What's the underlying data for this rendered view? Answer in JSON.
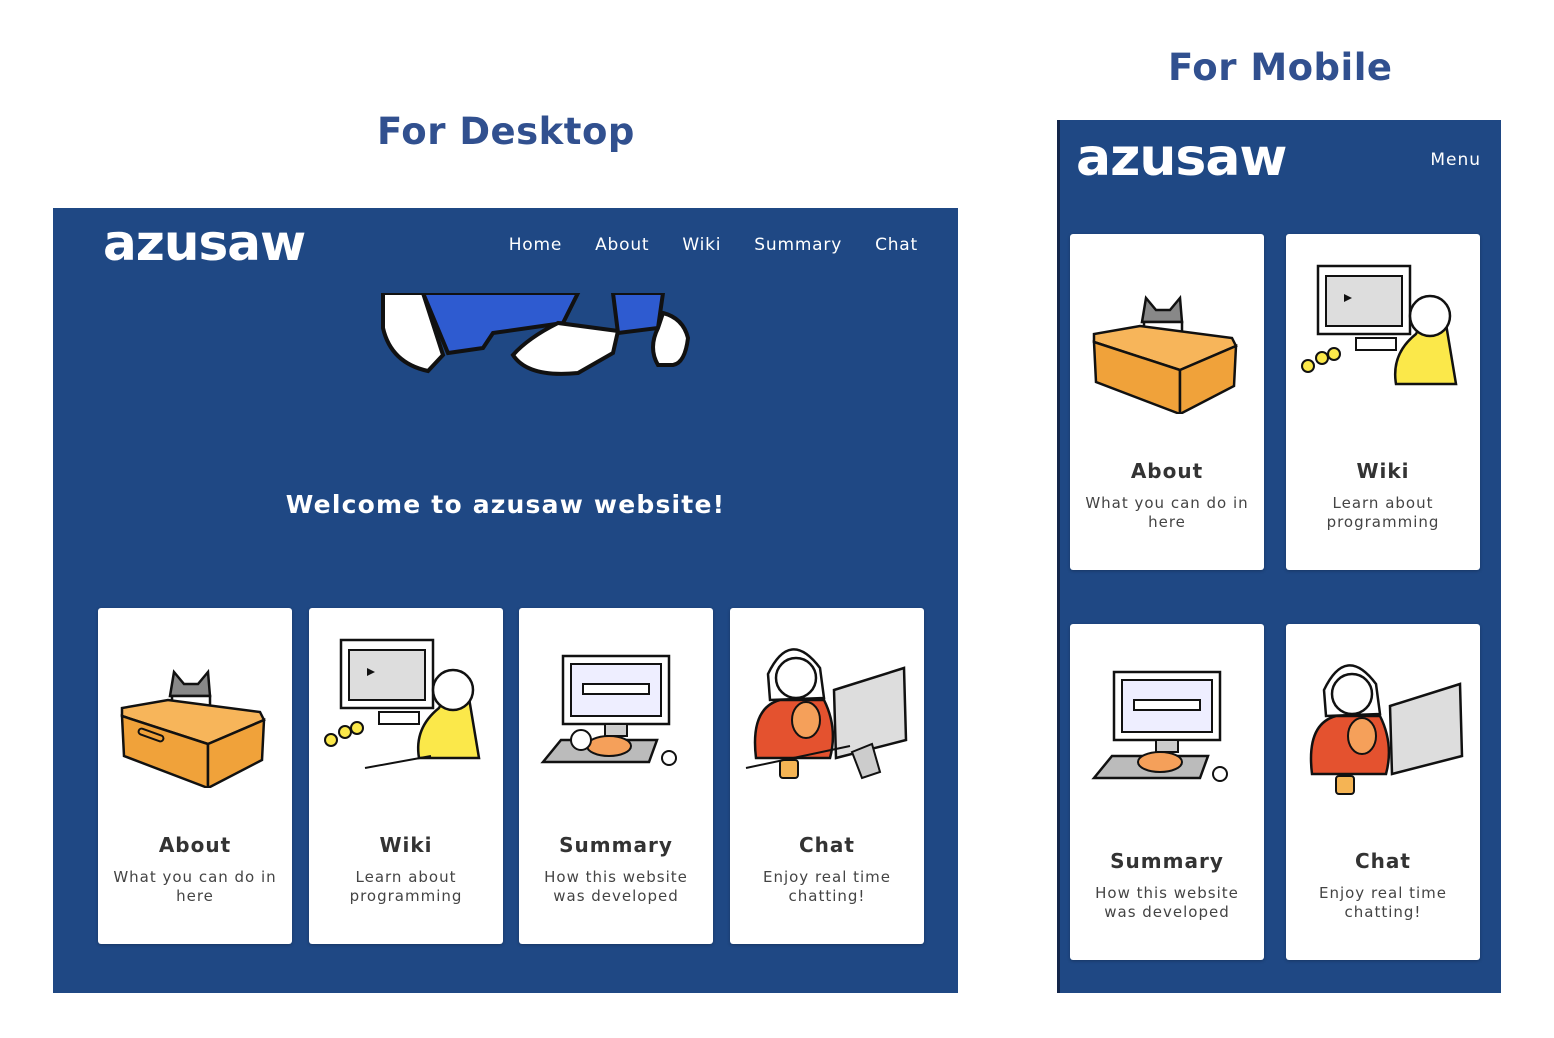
{
  "headings": {
    "desktop": "For Desktop",
    "mobile": "For Mobile"
  },
  "site": {
    "logo": "azusaw",
    "welcome": "Welcome to azusaw website!",
    "menu_label": "Menu"
  },
  "nav": [
    "Home",
    "About",
    "Wiki",
    "Summary",
    "Chat"
  ],
  "cards": [
    {
      "title": "About",
      "desc": "What you can do in here",
      "icon": "cat-in-box-illustration"
    },
    {
      "title": "Wiki",
      "desc": "Learn about programming",
      "icon": "person-at-computer-illustration"
    },
    {
      "title": "Summary",
      "desc": "How this website was developed",
      "icon": "cat-on-keyboard-illustration"
    },
    {
      "title": "Chat",
      "desc": "Enjoy real time chatting!",
      "icon": "person-holding-cat-illustration"
    }
  ],
  "colors": {
    "frame_bg": "#1f4884",
    "heading": "#31508f",
    "box_orange": "#f0a23a",
    "shirt_yellow": "#fbe84a",
    "shirt_red": "#e4522f",
    "pants_blue": "#2e5bd0"
  }
}
